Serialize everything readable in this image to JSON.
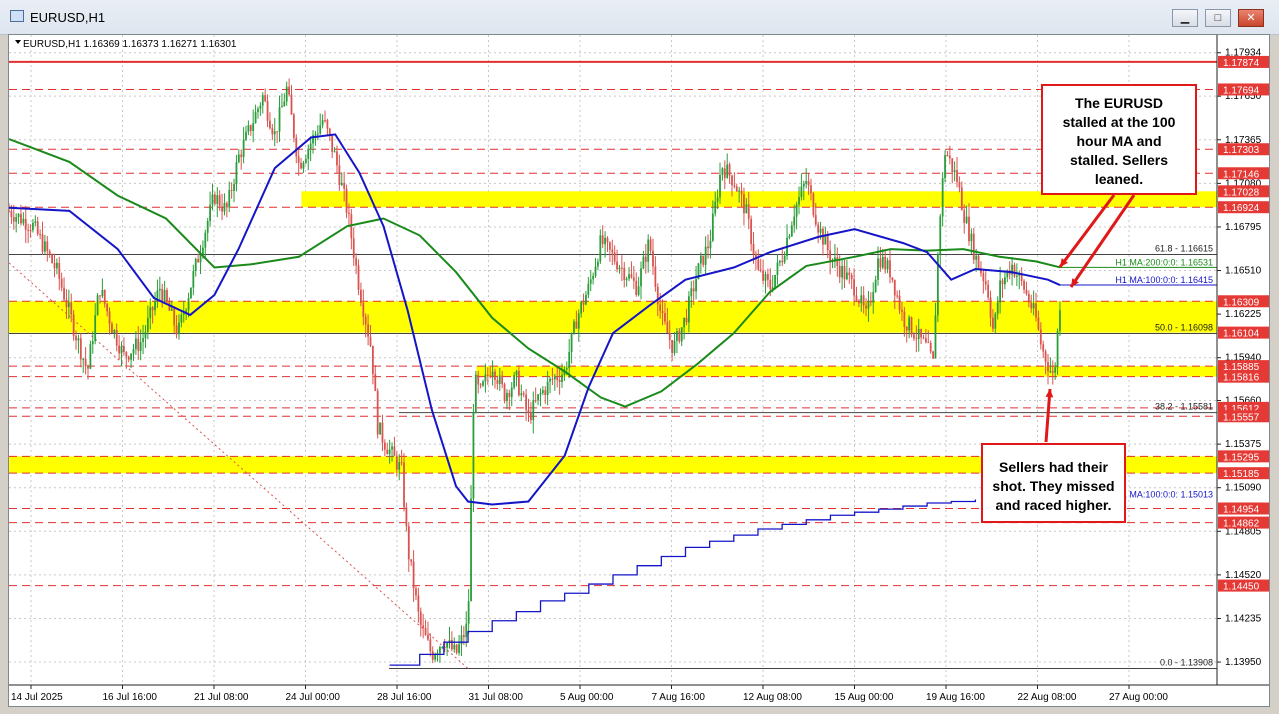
{
  "window": {
    "title": "EURUSD,H1",
    "min_symbol": "▁",
    "max_symbol": "□",
    "close_symbol": "✕"
  },
  "chart_header": "EURUSD,H1  1.16369 1.16373 1.16271 1.16301",
  "colors": {
    "candle_up": "#2a9d3a",
    "candle_down": "#d9534f",
    "ma100": "#1515c8",
    "ma200": "#1a8a1a",
    "daily_ma100": "#1515c8",
    "level_line": "#e03030",
    "zone": "#ffff00",
    "price_tag": "#e53935",
    "callout_border": "#e01818"
  },
  "chart_data": {
    "type": "candlestick",
    "title": "EURUSD,H1",
    "ohlc_header": {
      "open": 1.16369,
      "high": 1.16373,
      "low": 1.16271,
      "close": 1.16301
    },
    "ylim": [
      1.138,
      1.1805
    ],
    "x_tick_labels": [
      "14 Jul 2025",
      "16 Jul 16:00",
      "21 Jul 08:00",
      "24 Jul 00:00",
      "28 Jul 16:00",
      "31 Jul 08:00",
      "5 Aug 00:00",
      "7 Aug 16:00",
      "12 Aug 08:00",
      "15 Aug 00:00",
      "19 Aug 16:00",
      "22 Aug 08:00",
      "27 Aug 00:00"
    ],
    "y_tick_labels": [
      "1.17934",
      "1.17650",
      "1.17365",
      "1.17080",
      "1.16795",
      "1.16510",
      "1.16225",
      "1.15940",
      "1.15660",
      "1.15375",
      "1.15090",
      "1.14805",
      "1.14520",
      "1.14235",
      "1.13950"
    ],
    "price_tags": [
      "1.17874",
      "1.17694",
      "1.17303",
      "1.17146",
      "1.17028",
      "1.16924",
      "1.16309",
      "1.16104",
      "1.15885",
      "1.15816",
      "1.15612",
      "1.15557",
      "1.15295",
      "1.15185",
      "1.14954",
      "1.14862",
      "1.14450"
    ],
    "solid_levels": [
      1.17874
    ],
    "dashed_levels": [
      1.17694,
      1.17303,
      1.17146,
      1.16924,
      1.16309,
      1.15885,
      1.15816,
      1.15612,
      1.15557,
      1.15295,
      1.15185,
      1.14954,
      1.14862,
      1.1445
    ],
    "zones": [
      {
        "from": 1.16924,
        "to": 1.17028,
        "x_start": 0.242
      },
      {
        "from": 1.16104,
        "to": 1.16309,
        "x_start": 0
      },
      {
        "from": 1.15816,
        "to": 1.15885,
        "x_start": 0.387
      },
      {
        "from": 1.15185,
        "to": 1.15295,
        "x_start": 0
      }
    ],
    "fib_levels": [
      {
        "label": "61.8 - 1.16615",
        "value": 1.16615
      },
      {
        "label": "50.0 - 1.16098",
        "value": 1.16098
      },
      {
        "label": "38.2 - 1.15581",
        "value": 1.15581
      },
      {
        "label": "0.0 - 1.13908",
        "value": 1.13908
      }
    ],
    "fib_diagonal": [
      {
        "x": 0,
        "y": 1.1656
      },
      {
        "x": 0.38,
        "y": 1.13908
      }
    ],
    "ma_labels": [
      {
        "label": "H1 MA:200:0:0: 1.16531",
        "value": 1.16531
      },
      {
        "label": "H1 MA:100:0:0: 1.16415",
        "value": 1.16415
      },
      {
        "label": "1 MA:100:0:0: 1.15013",
        "value": 1.15013
      }
    ],
    "series": [
      {
        "name": "H1 MA:100",
        "points": [
          [
            0,
            1.1692
          ],
          [
            0.05,
            1.169
          ],
          [
            0.09,
            1.1665
          ],
          [
            0.12,
            1.1633
          ],
          [
            0.15,
            1.1622
          ],
          [
            0.17,
            1.1635
          ],
          [
            0.19,
            1.1665
          ],
          [
            0.22,
            1.1718
          ],
          [
            0.25,
            1.1738
          ],
          [
            0.27,
            1.174
          ],
          [
            0.29,
            1.1715
          ],
          [
            0.31,
            1.168
          ],
          [
            0.33,
            1.1625
          ],
          [
            0.35,
            1.156
          ],
          [
            0.37,
            1.151
          ],
          [
            0.38,
            1.15
          ],
          [
            0.4,
            1.1498
          ],
          [
            0.43,
            1.15
          ],
          [
            0.46,
            1.153
          ],
          [
            0.48,
            1.1575
          ],
          [
            0.5,
            1.161
          ],
          [
            0.53,
            1.1628
          ],
          [
            0.56,
            1.1645
          ],
          [
            0.6,
            1.1653
          ],
          [
            0.63,
            1.1663
          ],
          [
            0.67,
            1.1673
          ],
          [
            0.7,
            1.1678
          ],
          [
            0.74,
            1.1669
          ],
          [
            0.76,
            1.1663
          ],
          [
            0.78,
            1.1645
          ],
          [
            0.8,
            1.1652
          ],
          [
            0.83,
            1.165
          ],
          [
            0.86,
            1.1645
          ],
          [
            0.87,
            1.16415
          ]
        ]
      },
      {
        "name": "H1 MA:200",
        "points": [
          [
            0,
            1.1737
          ],
          [
            0.05,
            1.1722
          ],
          [
            0.09,
            1.17
          ],
          [
            0.13,
            1.1685
          ],
          [
            0.17,
            1.1653
          ],
          [
            0.2,
            1.1655
          ],
          [
            0.24,
            1.166
          ],
          [
            0.28,
            1.168
          ],
          [
            0.31,
            1.1685
          ],
          [
            0.34,
            1.1674
          ],
          [
            0.37,
            1.165
          ],
          [
            0.4,
            1.162
          ],
          [
            0.43,
            1.16
          ],
          [
            0.46,
            1.1585
          ],
          [
            0.49,
            1.1568
          ],
          [
            0.51,
            1.1562
          ],
          [
            0.54,
            1.1572
          ],
          [
            0.57,
            1.159
          ],
          [
            0.6,
            1.161
          ],
          [
            0.63,
            1.1637
          ],
          [
            0.66,
            1.1654
          ],
          [
            0.7,
            1.166
          ],
          [
            0.73,
            1.1665
          ],
          [
            0.76,
            1.1664
          ],
          [
            0.79,
            1.1665
          ],
          [
            0.82,
            1.166
          ],
          [
            0.85,
            1.1657
          ],
          [
            0.87,
            1.16531
          ]
        ]
      },
      {
        "name": "D1 MA:100",
        "steps": [
          [
            0.315,
            1.1393
          ],
          [
            0.34,
            1.14
          ],
          [
            0.36,
            1.1408
          ],
          [
            0.38,
            1.1415
          ],
          [
            0.4,
            1.1422
          ],
          [
            0.42,
            1.1428
          ],
          [
            0.44,
            1.1435
          ],
          [
            0.46,
            1.144
          ],
          [
            0.48,
            1.1446
          ],
          [
            0.5,
            1.1452
          ],
          [
            0.52,
            1.1458
          ],
          [
            0.54,
            1.1464
          ],
          [
            0.56,
            1.147
          ],
          [
            0.58,
            1.1474
          ],
          [
            0.6,
            1.1478
          ],
          [
            0.62,
            1.1482
          ],
          [
            0.64,
            1.1485
          ],
          [
            0.66,
            1.1488
          ],
          [
            0.68,
            1.1491
          ],
          [
            0.7,
            1.1493
          ],
          [
            0.72,
            1.1495
          ],
          [
            0.74,
            1.1497
          ],
          [
            0.76,
            1.1499
          ],
          [
            0.78,
            1.15
          ],
          [
            0.8,
            1.15013
          ]
        ]
      },
      {
        "name": "price path",
        "points": [
          [
            0,
            1.169
          ],
          [
            0.02,
            1.168
          ],
          [
            0.04,
            1.165
          ],
          [
            0.055,
            1.161
          ],
          [
            0.065,
            1.1585
          ],
          [
            0.075,
            1.164
          ],
          [
            0.085,
            1.1615
          ],
          [
            0.095,
            1.1595
          ],
          [
            0.11,
            1.1605
          ],
          [
            0.125,
            1.164
          ],
          [
            0.14,
            1.161
          ],
          [
            0.155,
            1.1655
          ],
          [
            0.17,
            1.17
          ],
          [
            0.18,
            1.169
          ],
          [
            0.19,
            1.1725
          ],
          [
            0.2,
            1.1745
          ],
          [
            0.21,
            1.1765
          ],
          [
            0.22,
            1.174
          ],
          [
            0.23,
            1.177
          ],
          [
            0.24,
            1.172
          ],
          [
            0.25,
            1.1735
          ],
          [
            0.26,
            1.175
          ],
          [
            0.27,
            1.1725
          ],
          [
            0.28,
            1.169
          ],
          [
            0.29,
            1.164
          ],
          [
            0.3,
            1.16
          ],
          [
            0.305,
            1.155
          ],
          [
            0.31,
            1.154
          ],
          [
            0.325,
            1.152
          ],
          [
            0.33,
            1.147
          ],
          [
            0.34,
            1.142
          ],
          [
            0.35,
            1.14
          ],
          [
            0.36,
            1.141
          ],
          [
            0.37,
            1.14
          ],
          [
            0.38,
            1.142
          ],
          [
            0.385,
            1.158
          ],
          [
            0.39,
            1.157
          ],
          [
            0.4,
            1.159
          ],
          [
            0.41,
            1.157
          ],
          [
            0.42,
            1.158
          ],
          [
            0.43,
            1.1555
          ],
          [
            0.44,
            1.157
          ],
          [
            0.45,
            1.158
          ],
          [
            0.46,
            1.1585
          ],
          [
            0.47,
            1.162
          ],
          [
            0.48,
            1.164
          ],
          [
            0.49,
            1.167
          ],
          [
            0.5,
            1.166
          ],
          [
            0.51,
            1.165
          ],
          [
            0.52,
            1.164
          ],
          [
            0.53,
            1.167
          ],
          [
            0.54,
            1.162
          ],
          [
            0.55,
            1.16
          ],
          [
            0.56,
            1.162
          ],
          [
            0.57,
            1.165
          ],
          [
            0.58,
            1.167
          ],
          [
            0.59,
            1.172
          ],
          [
            0.6,
            1.171
          ],
          [
            0.61,
            1.169
          ],
          [
            0.62,
            1.165
          ],
          [
            0.63,
            1.164
          ],
          [
            0.64,
            1.166
          ],
          [
            0.65,
            1.169
          ],
          [
            0.66,
            1.171
          ],
          [
            0.67,
            1.168
          ],
          [
            0.68,
            1.166
          ],
          [
            0.69,
            1.165
          ],
          [
            0.7,
            1.164
          ],
          [
            0.71,
            1.162
          ],
          [
            0.72,
            1.166
          ],
          [
            0.73,
            1.165
          ],
          [
            0.74,
            1.162
          ],
          [
            0.75,
            1.161
          ],
          [
            0.76,
            1.16
          ],
          [
            0.765,
            1.159
          ],
          [
            0.77,
            1.168
          ],
          [
            0.775,
            1.173
          ],
          [
            0.78,
            1.172
          ],
          [
            0.785,
            1.171
          ],
          [
            0.79,
            1.169
          ],
          [
            0.8,
            1.166
          ],
          [
            0.81,
            1.164
          ],
          [
            0.815,
            1.161
          ],
          [
            0.82,
            1.164
          ],
          [
            0.83,
            1.1655
          ],
          [
            0.84,
            1.164
          ],
          [
            0.85,
            1.162
          ],
          [
            0.855,
            1.16
          ],
          [
            0.86,
            1.159
          ],
          [
            0.865,
            1.158
          ],
          [
            0.87,
            1.163
          ]
        ]
      }
    ]
  },
  "callouts": {
    "top": [
      "The EURUSD",
      "stalled at the 100",
      "hour MA and",
      "stalled.  Sellers",
      "leaned."
    ],
    "bottom": [
      "Sellers had their",
      "shot. They missed",
      "and raced higher."
    ]
  }
}
